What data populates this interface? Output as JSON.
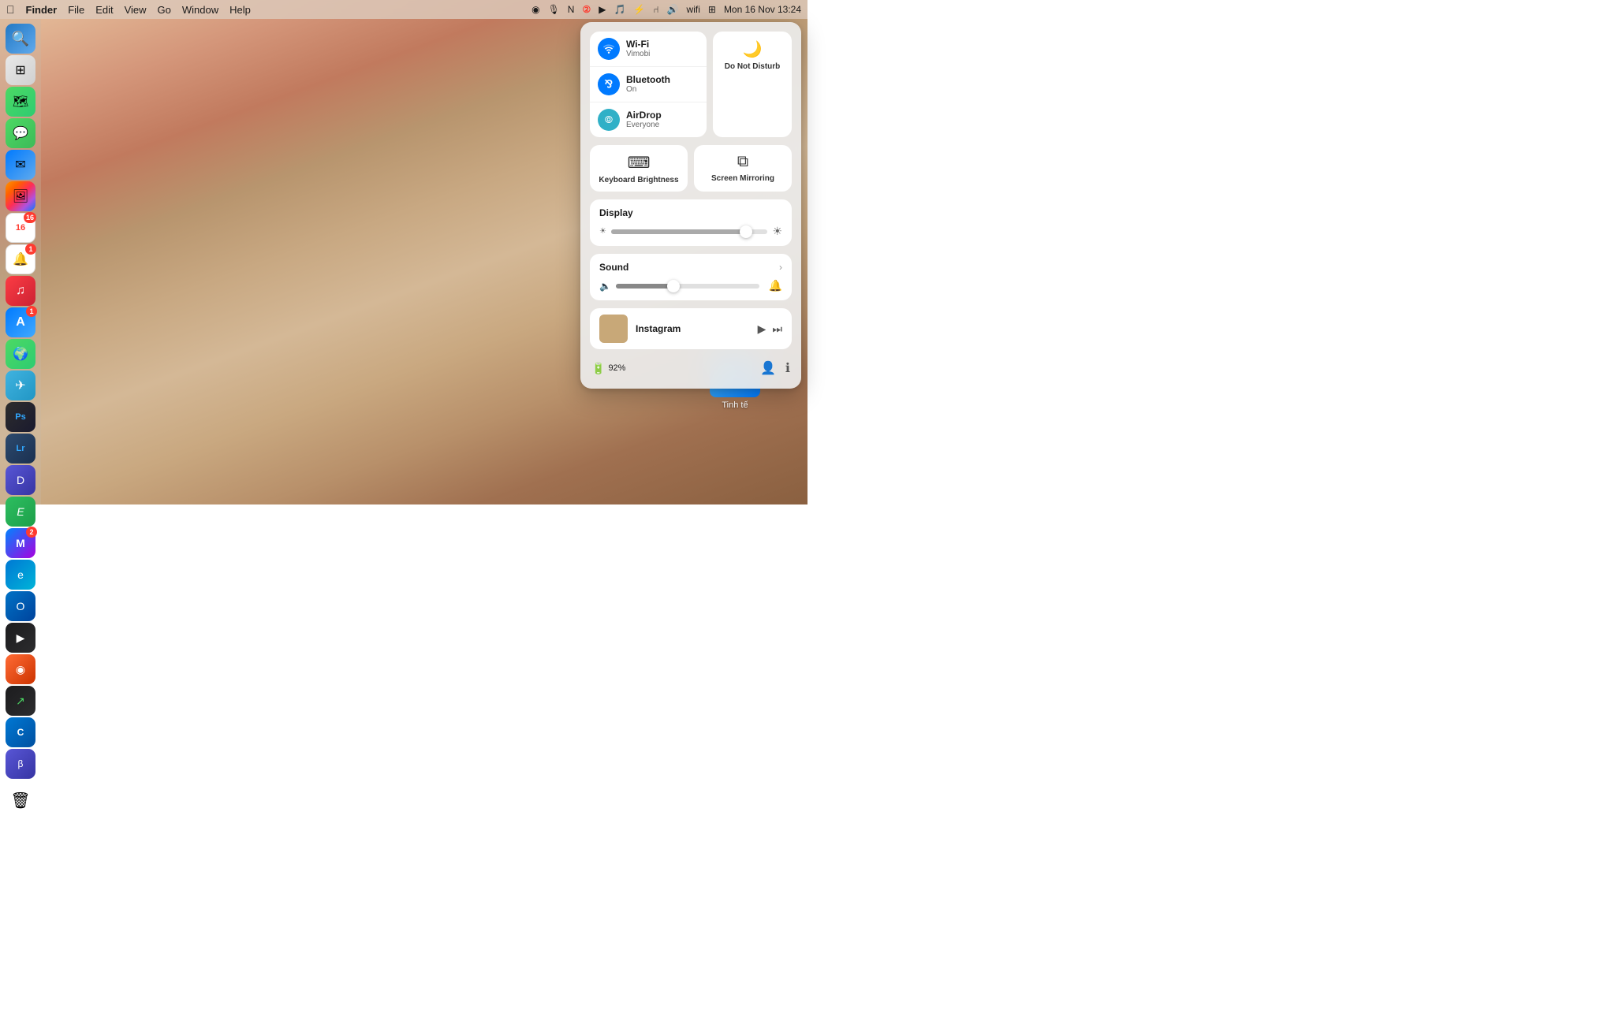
{
  "menubar": {
    "apple_label": "",
    "finder_label": "Finder",
    "file_label": "File",
    "edit_label": "Edit",
    "view_label": "View",
    "go_label": "Go",
    "window_label": "Window",
    "help_label": "Help",
    "time": "Mon 16 Nov  13:24",
    "icons": [
      "location",
      "dictation",
      "notch",
      "badge",
      "music",
      "podcast",
      "activity",
      "bluetooth",
      "volume",
      "wifi",
      "notifications"
    ]
  },
  "control_center": {
    "wifi": {
      "title": "Wi-Fi",
      "subtitle": "Vimobi"
    },
    "bluetooth": {
      "title": "Bluetooth",
      "subtitle": "On"
    },
    "airdrop": {
      "title": "AirDrop",
      "subtitle": "Everyone"
    },
    "do_not_disturb": {
      "label": "Do Not\nDisturb"
    },
    "keyboard_brightness": {
      "label": "Keyboard\nBrightness"
    },
    "screen_mirroring": {
      "label": "Screen\nMirroring"
    },
    "display": {
      "title": "Display",
      "brightness_pct": 88
    },
    "sound": {
      "title": "Sound",
      "volume_pct": 38
    },
    "now_playing": {
      "app": "Instagram",
      "album_color": "#d4b896"
    },
    "battery": {
      "pct": "92%",
      "label": "92%"
    }
  },
  "desktop": {
    "folder": {
      "label": "Tinh tế"
    }
  },
  "dock": {
    "apps": [
      {
        "name": "Finder",
        "class": "app-finder",
        "icon": "🔍"
      },
      {
        "name": "Launchpad",
        "class": "app-launchpad",
        "icon": "⊞"
      },
      {
        "name": "Maps",
        "class": "app-maps",
        "icon": "🗺"
      },
      {
        "name": "Messages",
        "class": "app-messages",
        "icon": "💬"
      },
      {
        "name": "Mail",
        "class": "app-mail",
        "icon": "✉️"
      },
      {
        "name": "Photos",
        "class": "app-photos",
        "icon": "🖼"
      },
      {
        "name": "Calendar",
        "class": "app-calendar",
        "icon": "📅",
        "badge": "16"
      },
      {
        "name": "Reminders",
        "class": "app-reminders",
        "icon": "🔔",
        "badge": "1"
      },
      {
        "name": "Music",
        "class": "app-music",
        "icon": "♫"
      },
      {
        "name": "AppStore",
        "class": "app-appstore",
        "icon": "A",
        "badge": "1"
      },
      {
        "name": "Maps2",
        "class": "app-maps2",
        "icon": "🌍"
      },
      {
        "name": "Telegram",
        "class": "app-telegram",
        "icon": "✈"
      },
      {
        "name": "Photoshop",
        "class": "app-ps",
        "icon": "Ps"
      },
      {
        "name": "Lightroom",
        "class": "app-lr",
        "icon": "Lr"
      },
      {
        "name": "DevMate",
        "class": "app-devmate",
        "icon": "D"
      },
      {
        "name": "Evernote",
        "class": "app-evernote",
        "icon": "E"
      },
      {
        "name": "Messenger",
        "class": "app-messenger",
        "icon": "M",
        "badge": "2"
      },
      {
        "name": "Edge",
        "class": "app-edge",
        "icon": "e"
      },
      {
        "name": "Outlook",
        "class": "app-outlook",
        "icon": "O"
      },
      {
        "name": "AppleTV",
        "class": "app-appletv",
        "icon": "▶"
      },
      {
        "name": "Arc",
        "class": "app-arc",
        "icon": "◉"
      },
      {
        "name": "Stocks",
        "class": "app-stocks",
        "icon": "📈"
      },
      {
        "name": "Copilot",
        "class": "app-copilot",
        "icon": "C"
      },
      {
        "name": "Beta",
        "class": "app-beta",
        "icon": "β"
      },
      {
        "name": "Trash",
        "class": "app-trash",
        "icon": "🗑"
      }
    ]
  }
}
